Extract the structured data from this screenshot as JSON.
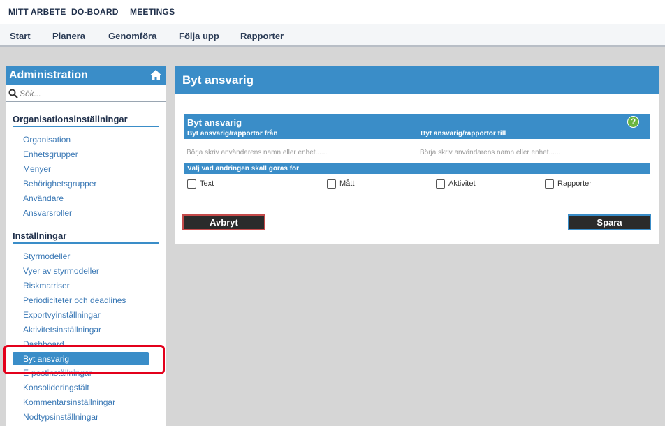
{
  "topnav": [
    "MITT ARBETE",
    "DO-BOARD",
    "MEETINGS"
  ],
  "subnav": [
    "Start",
    "Planera",
    "Genomföra",
    "Följa upp",
    "Rapporter"
  ],
  "sidebar": {
    "title": "Administration",
    "home_icon": "home-icon",
    "search_placeholder": "Sök...",
    "sections": [
      {
        "title": "Organisationsinställningar",
        "items": [
          "Organisation",
          "Enhetsgrupper",
          "Menyer",
          "Behörighetsgrupper",
          "Användare",
          "Ansvarsroller"
        ]
      },
      {
        "title": "Inställningar",
        "items": [
          "Styrmodeller",
          "Vyer av styrmodeller",
          "Riskmatriser",
          "Periodiciteter och deadlines",
          "Exportvyinställningar",
          "Aktivitetsinställningar",
          "Dashboard",
          "Byt ansvarig",
          "E-postinställningar",
          "Konsolideringsfält",
          "Kommentarsinställningar",
          "Nodtypsinställningar"
        ]
      }
    ],
    "active_item": "Byt ansvarig"
  },
  "main": {
    "title": "Byt ansvarig",
    "fieldset_title": "Byt ansvarig",
    "help_icon": "help-icon",
    "from_label": "Byt ansvarig/rapportör från",
    "to_label": "Byt ansvarig/rapportör till",
    "from_placeholder": "Börja skriv användarens namn eller enhet......",
    "to_placeholder": "Börja skriv användarens namn eller enhet......",
    "choose_label": "Välj vad ändringen skall göras för",
    "checkboxes": [
      {
        "label": "Text",
        "checked": false
      },
      {
        "label": "Mått",
        "checked": false
      },
      {
        "label": "Aktivitet",
        "checked": false
      },
      {
        "label": "Rapporter",
        "checked": false
      }
    ],
    "cancel_label": "Avbryt",
    "save_label": "Spara"
  },
  "colors": {
    "accent": "#3a8dc8",
    "button_dark": "#2b2b2b",
    "highlight": "#e3001b",
    "help_green": "#6ab43e",
    "link": "#3a78b5"
  }
}
